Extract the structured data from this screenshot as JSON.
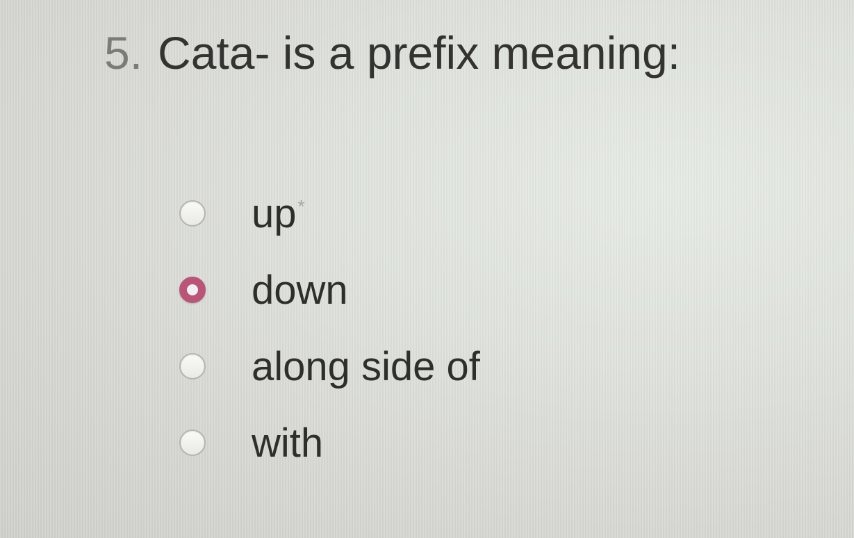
{
  "question": {
    "number": "5.",
    "text": "Cata- is a prefix meaning:"
  },
  "options": [
    {
      "label": "up",
      "selected": false,
      "marker": "*"
    },
    {
      "label": "down",
      "selected": true
    },
    {
      "label": "along side of",
      "selected": false
    },
    {
      "label": "with",
      "selected": false
    }
  ],
  "colors": {
    "selected_radio": "#b85578",
    "question_text": "#333331",
    "question_number": "#7b7b78"
  }
}
